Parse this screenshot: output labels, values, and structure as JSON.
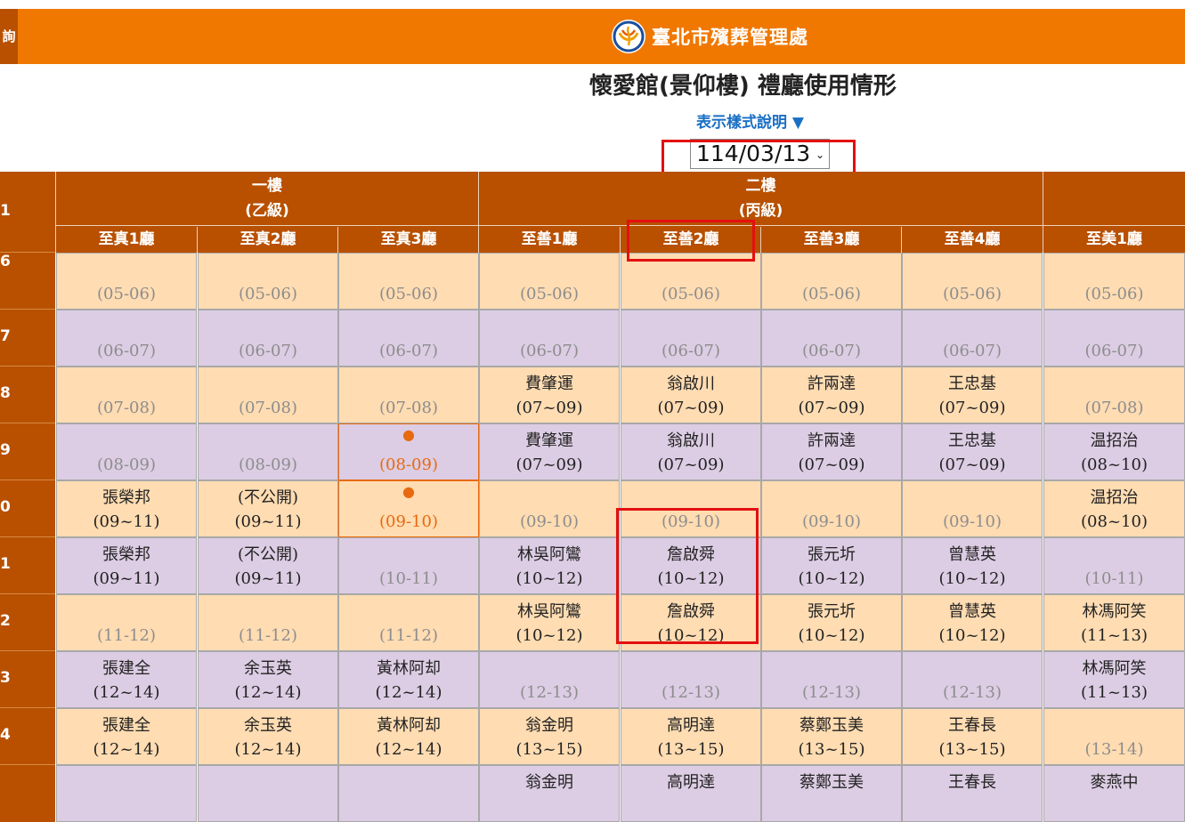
{
  "header": {
    "left_tab": "詢",
    "org_name": "臺北市殯葬管理處",
    "page_title": "懷愛館(景仰樓) 禮廳使用情形",
    "legend_link": "表示樣式說明 ▼",
    "date_value": "114/03/13",
    "date_chevron": "⌄"
  },
  "floors": [
    {
      "name": "一樓",
      "grade": "(乙級)"
    },
    {
      "name": "二樓",
      "grade": "(丙級)"
    }
  ],
  "halls": [
    "至真1廳",
    "至真2廳",
    "至真3廳",
    "至善1廳",
    "至善2廳",
    "至善3廳",
    "至善4廳",
    "至美1廳"
  ],
  "time_col_header": "1",
  "time_rows": [
    "6",
    "7",
    "8",
    "9",
    "0",
    "1",
    "2",
    "3",
    "4",
    ""
  ],
  "rows": [
    [
      {
        "time": "(05-06)",
        "state": "free"
      },
      {
        "time": "(05-06)",
        "state": "free"
      },
      {
        "time": "(05-06)",
        "state": "free"
      },
      {
        "time": "(05-06)",
        "state": "free"
      },
      {
        "time": "(05-06)",
        "state": "free"
      },
      {
        "time": "(05-06)",
        "state": "free"
      },
      {
        "time": "(05-06)",
        "state": "free"
      },
      {
        "time": "(05-06)",
        "state": "free"
      }
    ],
    [
      {
        "time": "(06-07)",
        "state": "free"
      },
      {
        "time": "(06-07)",
        "state": "free"
      },
      {
        "time": "(06-07)",
        "state": "free"
      },
      {
        "time": "(06-07)",
        "state": "free"
      },
      {
        "time": "(06-07)",
        "state": "free"
      },
      {
        "time": "(06-07)",
        "state": "free"
      },
      {
        "time": "(06-07)",
        "state": "free"
      },
      {
        "time": "(06-07)",
        "state": "free"
      }
    ],
    [
      {
        "time": "(07-08)",
        "state": "free"
      },
      {
        "time": "(07-08)",
        "state": "free"
      },
      {
        "time": "(07-08)",
        "state": "free"
      },
      {
        "name": "費肇運",
        "time": "(07~09)",
        "state": "booked"
      },
      {
        "name": "翁啟川",
        "time": "(07~09)",
        "state": "booked"
      },
      {
        "name": "許兩達",
        "time": "(07~09)",
        "state": "booked"
      },
      {
        "name": "王忠基",
        "time": "(07~09)",
        "state": "booked"
      },
      {
        "time": "(07-08)",
        "state": "free"
      }
    ],
    [
      {
        "time": "(08-09)",
        "state": "free"
      },
      {
        "time": "(08-09)",
        "state": "free"
      },
      {
        "dot": "●",
        "time": "(08-09)",
        "state": "pending"
      },
      {
        "name": "費肇運",
        "time": "(07~09)",
        "state": "booked"
      },
      {
        "name": "翁啟川",
        "time": "(07~09)",
        "state": "booked"
      },
      {
        "name": "許兩達",
        "time": "(07~09)",
        "state": "booked"
      },
      {
        "name": "王忠基",
        "time": "(07~09)",
        "state": "booked"
      },
      {
        "name": "温招治",
        "time": "(08~10)",
        "state": "booked"
      }
    ],
    [
      {
        "name": "張榮邦",
        "time": "(09~11)",
        "state": "booked"
      },
      {
        "name": "(不公開)",
        "time": "(09~11)",
        "state": "booked"
      },
      {
        "dot": "●",
        "time": "(09-10)",
        "state": "pending"
      },
      {
        "time": "(09-10)",
        "state": "free"
      },
      {
        "time": "(09-10)",
        "state": "free"
      },
      {
        "time": "(09-10)",
        "state": "free"
      },
      {
        "time": "(09-10)",
        "state": "free"
      },
      {
        "name": "温招治",
        "time": "(08~10)",
        "state": "booked"
      }
    ],
    [
      {
        "name": "張榮邦",
        "time": "(09~11)",
        "state": "booked"
      },
      {
        "name": "(不公開)",
        "time": "(09~11)",
        "state": "booked"
      },
      {
        "time": "(10-11)",
        "state": "free"
      },
      {
        "name": "林吳阿鸞",
        "time": "(10~12)",
        "state": "booked"
      },
      {
        "name": "詹啟舜",
        "time": "(10~12)",
        "state": "booked"
      },
      {
        "name": "張元圻",
        "time": "(10~12)",
        "state": "booked"
      },
      {
        "name": "曾慧英",
        "time": "(10~12)",
        "state": "booked"
      },
      {
        "time": "(10-11)",
        "state": "free"
      }
    ],
    [
      {
        "time": "(11-12)",
        "state": "free"
      },
      {
        "time": "(11-12)",
        "state": "free"
      },
      {
        "time": "(11-12)",
        "state": "free"
      },
      {
        "name": "林吳阿鸞",
        "time": "(10~12)",
        "state": "booked"
      },
      {
        "name": "詹啟舜",
        "time": "(10~12)",
        "state": "booked"
      },
      {
        "name": "張元圻",
        "time": "(10~12)",
        "state": "booked"
      },
      {
        "name": "曾慧英",
        "time": "(10~12)",
        "state": "booked"
      },
      {
        "name": "林馮阿笑",
        "time": "(11~13)",
        "state": "booked"
      }
    ],
    [
      {
        "name": "張建全",
        "time": "(12~14)",
        "state": "booked"
      },
      {
        "name": "余玉英",
        "time": "(12~14)",
        "state": "booked"
      },
      {
        "name": "黃林阿却",
        "time": "(12~14)",
        "state": "booked"
      },
      {
        "time": "(12-13)",
        "state": "free"
      },
      {
        "time": "(12-13)",
        "state": "free"
      },
      {
        "time": "(12-13)",
        "state": "free"
      },
      {
        "time": "(12-13)",
        "state": "free"
      },
      {
        "name": "林馮阿笑",
        "time": "(11~13)",
        "state": "booked"
      }
    ],
    [
      {
        "name": "張建全",
        "time": "(12~14)",
        "state": "booked"
      },
      {
        "name": "余玉英",
        "time": "(12~14)",
        "state": "booked"
      },
      {
        "name": "黃林阿却",
        "time": "(12~14)",
        "state": "booked"
      },
      {
        "name": "翁金明",
        "time": "(13~15)",
        "state": "booked"
      },
      {
        "name": "高明達",
        "time": "(13~15)",
        "state": "booked"
      },
      {
        "name": "蔡鄭玉美",
        "time": "(13~15)",
        "state": "booked"
      },
      {
        "name": "王春長",
        "time": "(13~15)",
        "state": "booked"
      },
      {
        "time": "(13-14)",
        "state": "free"
      }
    ],
    [
      {
        "time": "",
        "state": "free"
      },
      {
        "time": "",
        "state": "free"
      },
      {
        "time": "",
        "state": "free"
      },
      {
        "name": "翁金明",
        "time": "",
        "state": "booked"
      },
      {
        "name": "高明達",
        "time": "",
        "state": "booked"
      },
      {
        "name": "蔡鄭玉美",
        "time": "",
        "state": "booked"
      },
      {
        "name": "王春長",
        "time": "",
        "state": "booked"
      },
      {
        "name": "麥燕中",
        "time": "",
        "state": "booked"
      }
    ]
  ],
  "colors": {
    "orange_bar": "#f07800",
    "brown_header": "#b85000",
    "peach_row": "#ffdcb2",
    "lavender_row": "#dccde4",
    "free_text": "#8d8d8d",
    "pending_text": "#e86a10",
    "highlight_red": "#e31010"
  }
}
